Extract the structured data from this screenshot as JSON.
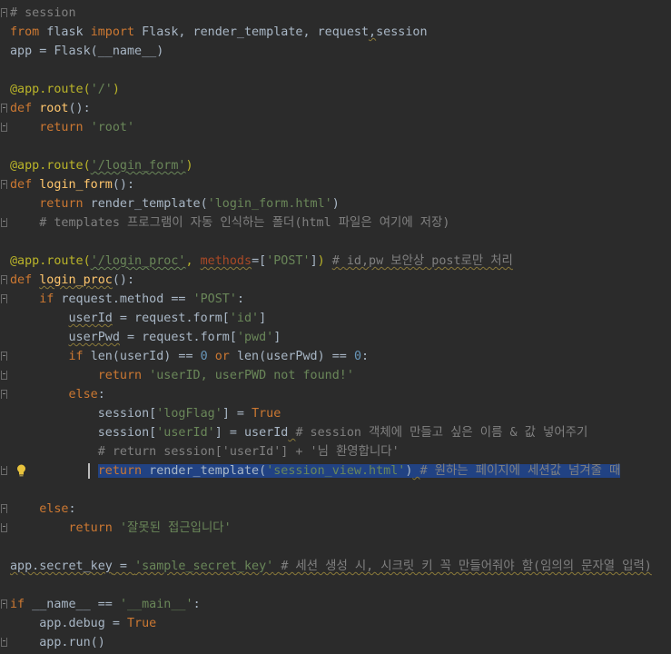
{
  "editor": {
    "lines": [
      [
        {
          "t": "# session",
          "c": "com"
        }
      ],
      [
        {
          "t": "from",
          "c": "kw"
        },
        {
          "t": " flask "
        },
        {
          "t": "import",
          "c": "kw"
        },
        {
          "t": " Flask, render_template, request"
        },
        {
          "t": ",",
          "c": "sq"
        },
        {
          "t": "session"
        }
      ],
      [
        {
          "t": "app = Flask(__name__)"
        }
      ],
      [],
      [
        {
          "t": "@app.route(",
          "c": "dec"
        },
        {
          "t": "'/'",
          "c": "str"
        },
        {
          "t": ")",
          "c": "dec"
        }
      ],
      [
        {
          "t": "def",
          "c": "kw"
        },
        {
          "t": " "
        },
        {
          "t": "root",
          "c": "fn"
        },
        {
          "t": "():"
        }
      ],
      [
        {
          "t": "    "
        },
        {
          "t": "return",
          "c": "kw"
        },
        {
          "t": " "
        },
        {
          "t": "'root'",
          "c": "str"
        }
      ],
      [],
      [
        {
          "t": "@app.route(",
          "c": "dec"
        },
        {
          "t": "'/login_form'",
          "c": "str sqg"
        },
        {
          "t": ")",
          "c": "dec"
        }
      ],
      [
        {
          "t": "def",
          "c": "kw"
        },
        {
          "t": " "
        },
        {
          "t": "login_form",
          "c": "fn"
        },
        {
          "t": "():"
        }
      ],
      [
        {
          "t": "    "
        },
        {
          "t": "return",
          "c": "kw"
        },
        {
          "t": " render_template("
        },
        {
          "t": "'login_form.html'",
          "c": "str"
        },
        {
          "t": ")"
        }
      ],
      [
        {
          "t": "    "
        },
        {
          "t": "# templates 프로그램이 자동 인식하는 폴더(html 파일은 여기에 저장)",
          "c": "com"
        }
      ],
      [],
      [
        {
          "t": "@app.route(",
          "c": "dec"
        },
        {
          "t": "'/login_proc'",
          "c": "str sqg"
        },
        {
          "t": ", ",
          "c": "dec"
        },
        {
          "t": "methods",
          "c": "prm sq"
        },
        {
          "t": "=["
        },
        {
          "t": "'POST'",
          "c": "str"
        },
        {
          "t": "]",
          "c": ""
        },
        {
          "t": ")",
          "c": "dec"
        },
        {
          "t": " "
        },
        {
          "t": "# id,pw 보안상 post로만 처리",
          "c": "com sq"
        }
      ],
      [
        {
          "t": "def",
          "c": "kw"
        },
        {
          "t": " "
        },
        {
          "t": "login_proc",
          "c": "fn sq"
        },
        {
          "t": "():"
        }
      ],
      [
        {
          "t": "    "
        },
        {
          "t": "if",
          "c": "kw"
        },
        {
          "t": " request.method == "
        },
        {
          "t": "'POST'",
          "c": "str"
        },
        {
          "t": ":"
        }
      ],
      [
        {
          "t": "        "
        },
        {
          "t": "userId",
          "c": "sq"
        },
        {
          "t": " = request.form["
        },
        {
          "t": "'id'",
          "c": "str"
        },
        {
          "t": "]"
        }
      ],
      [
        {
          "t": "        "
        },
        {
          "t": "userPwd",
          "c": "sq"
        },
        {
          "t": " = request.form["
        },
        {
          "t": "'pwd'",
          "c": "str"
        },
        {
          "t": "]"
        }
      ],
      [
        {
          "t": "        "
        },
        {
          "t": "if",
          "c": "kw"
        },
        {
          "t": " "
        },
        {
          "t": "len",
          "c": "fnb"
        },
        {
          "t": "(userId) == "
        },
        {
          "t": "0",
          "c": "num"
        },
        {
          "t": " "
        },
        {
          "t": "or",
          "c": "kw"
        },
        {
          "t": " "
        },
        {
          "t": "len",
          "c": "fnb"
        },
        {
          "t": "(userPwd) == "
        },
        {
          "t": "0",
          "c": "num"
        },
        {
          "t": ":"
        }
      ],
      [
        {
          "t": "            "
        },
        {
          "t": "return",
          "c": "kw"
        },
        {
          "t": " "
        },
        {
          "t": "'userID, userPWD not found!'",
          "c": "str"
        }
      ],
      [
        {
          "t": "        "
        },
        {
          "t": "else",
          "c": "kw"
        },
        {
          "t": ":"
        }
      ],
      [
        {
          "t": "            session["
        },
        {
          "t": "'logFlag'",
          "c": "str"
        },
        {
          "t": "] = "
        },
        {
          "t": "True",
          "c": "kw"
        }
      ],
      [
        {
          "t": "            session["
        },
        {
          "t": "'userId'",
          "c": "str"
        },
        {
          "t": "] = userId"
        },
        {
          "t": " ",
          "c": "sq"
        },
        {
          "t": "# session 객체에 만들고 싶은 이름 & 값 넣어주기",
          "c": "com"
        }
      ],
      [
        {
          "t": "            "
        },
        {
          "t": "# return session['userId'] + '님 환영합니다'",
          "c": "com"
        }
      ],
      [
        {
          "t": "            "
        },
        {
          "t": "return",
          "c": "kw sel"
        },
        {
          "t": " render_template(",
          "c": "sel"
        },
        {
          "t": "'session_view.html'",
          "c": "str sel"
        },
        {
          "t": ")",
          "c": "sel"
        },
        {
          "t": " ",
          "c": "sel sq"
        },
        {
          "t": "# 원하는 페이지에 세션값 넘겨줄 때",
          "c": "com sel"
        }
      ],
      [],
      [
        {
          "t": "    "
        },
        {
          "t": "else",
          "c": "kw"
        },
        {
          "t": ":"
        }
      ],
      [
        {
          "t": "        "
        },
        {
          "t": "return",
          "c": "kw"
        },
        {
          "t": " "
        },
        {
          "t": "'잘못된 접근입니다'",
          "c": "str"
        }
      ],
      [],
      [
        {
          "t": "app.secret_key",
          "c": "sq"
        },
        {
          "t": " = ",
          "c": "sq"
        },
        {
          "t": "'sample_secret_key'",
          "c": "str sq"
        },
        {
          "t": " ",
          "c": "sq"
        },
        {
          "t": "# 세션 생성 시, 시크릿 키 꼭 만들어줘야 함(임의의 문자열 입력)",
          "c": "com sq"
        }
      ],
      [],
      [
        {
          "t": "if",
          "c": "kw"
        },
        {
          "t": " __name__ == "
        },
        {
          "t": "'__main__'",
          "c": "str"
        },
        {
          "t": ":"
        }
      ],
      [
        {
          "t": "    app.debug = "
        },
        {
          "t": "True",
          "c": "kw"
        }
      ],
      [
        {
          "t": "    app.run()"
        }
      ]
    ],
    "fold_markers": {
      "0": "open",
      "5": "open",
      "6": "close",
      "9": "open",
      "11": "close",
      "14": "open",
      "15": "open",
      "18": "open",
      "19": "close",
      "20": "open",
      "24": "close",
      "26": "open",
      "27": "close",
      "31": "open",
      "33": "close"
    },
    "bulb_line": 24,
    "caret_line": 24,
    "lightbulb_icon": "lightbulb-icon",
    "colors": {
      "background": "#2b2b2b",
      "keyword": "#cc7832",
      "string": "#6a8759",
      "comment": "#808080",
      "decorator": "#bbb529",
      "function": "#ffc66d",
      "number": "#6897bb",
      "selection": "#214283"
    }
  }
}
